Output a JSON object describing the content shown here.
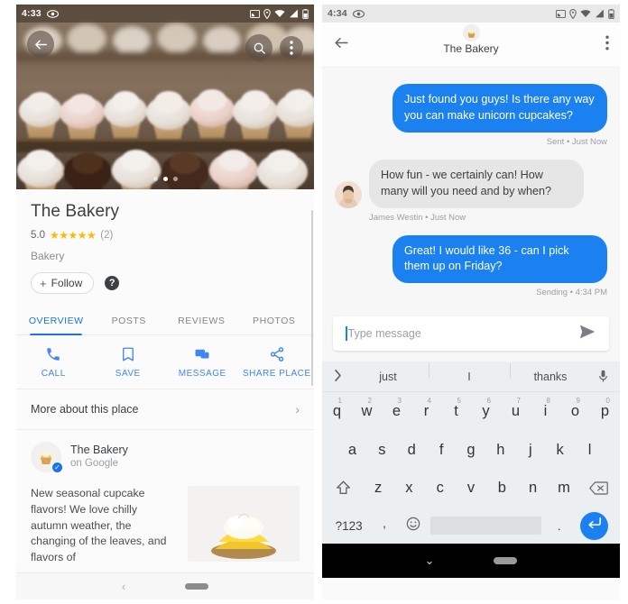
{
  "left_phone": {
    "status_bar": {
      "time": "4:33",
      "left_icons": [
        "eye-icon"
      ],
      "right_icons": [
        "cast-icon",
        "location-icon",
        "wifi-icon",
        "signal-icon",
        "battery-icon"
      ]
    },
    "photo_header": {
      "back_icon": "back-arrow-icon",
      "search_icon": "search-icon",
      "more_icon": "more-vertical-icon",
      "carousel_dots": 3,
      "active_dot": 1
    },
    "place": {
      "name": "The Bakery",
      "rating": "5.0",
      "stars": "★★★★★",
      "review_count": "(2)",
      "category": "Bakery",
      "follow_label": "Follow",
      "follow_plus": "+",
      "help_label": "?"
    },
    "tabs": [
      {
        "label": "OVERVIEW",
        "active": true
      },
      {
        "label": "POSTS",
        "active": false
      },
      {
        "label": "REVIEWS",
        "active": false
      },
      {
        "label": "PHOTOS",
        "active": false
      }
    ],
    "actions": [
      {
        "label": "CALL",
        "icon": "phone-icon"
      },
      {
        "label": "SAVE",
        "icon": "bookmark-icon"
      },
      {
        "label": "MESSAGE",
        "icon": "message-icon"
      },
      {
        "label": "SHARE PLACE",
        "icon": "share-icon"
      }
    ],
    "more_about": {
      "label": "More about this place",
      "chevron": "›"
    },
    "post": {
      "author": "The Bakery",
      "source": "on Google",
      "verified_mark": "✓",
      "avatar_glyph": "🧁",
      "text": "New seasonal cupcake flavors! We love chilly autumn weather, the changing of the leaves, and flavors of"
    },
    "navbar": {
      "back": "‹",
      "pill": ""
    },
    "accent_color": "#1a73e8",
    "star_color": "#fabb05"
  },
  "right_phone": {
    "status_bar": {
      "time": "4:34",
      "left_icons": [
        "eye-icon"
      ],
      "right_icons": [
        "cast-icon",
        "location-icon",
        "wifi-icon",
        "signal-icon",
        "battery-icon"
      ]
    },
    "header": {
      "back_icon": "back-arrow-icon",
      "avatar_glyph": "🧁",
      "title": "The Bakery",
      "more_icon": "more-vertical-icon"
    },
    "messages": [
      {
        "direction": "out",
        "text": "Just found you guys! Is there any way you can make unicorn cupcakes?",
        "meta": "Sent • Just Now"
      },
      {
        "direction": "in",
        "text": "How fun - we certainly can! How many will you need and by when?",
        "meta": "James Westin • Just Now"
      },
      {
        "direction": "out",
        "text": "Great! I would like 36 - can I pick them up on Friday?",
        "meta": "Sending • 4:34 PM"
      }
    ],
    "composer": {
      "placeholder": "Type message",
      "send_icon": "send-icon"
    },
    "bubble_out_color": "#1b81f0",
    "bubble_in_color": "#e6e6e6"
  },
  "keyboard": {
    "expand_icon": "chevron-right-icon",
    "suggestions": [
      "just",
      "I",
      "thanks"
    ],
    "mic_icon": "microphone-icon",
    "row1": [
      {
        "key": "q",
        "num": "1"
      },
      {
        "key": "w",
        "num": "2"
      },
      {
        "key": "e",
        "num": "3"
      },
      {
        "key": "r",
        "num": "4"
      },
      {
        "key": "t",
        "num": "5"
      },
      {
        "key": "y",
        "num": "6"
      },
      {
        "key": "u",
        "num": "7"
      },
      {
        "key": "i",
        "num": "8"
      },
      {
        "key": "o",
        "num": "9"
      },
      {
        "key": "p",
        "num": "0"
      }
    ],
    "row2": [
      "a",
      "s",
      "d",
      "f",
      "g",
      "h",
      "j",
      "k",
      "l"
    ],
    "row3": [
      "z",
      "x",
      "c",
      "v",
      "b",
      "n",
      "m"
    ],
    "shift_icon": "shift-icon",
    "backspace_icon": "backspace-icon",
    "numbers_key": "?123",
    "comma_key": ",",
    "emoji_key": "emoji-icon",
    "period_key": ".",
    "enter_icon": "enter-icon",
    "navbar": {
      "down": "⌄",
      "pill": ""
    }
  }
}
